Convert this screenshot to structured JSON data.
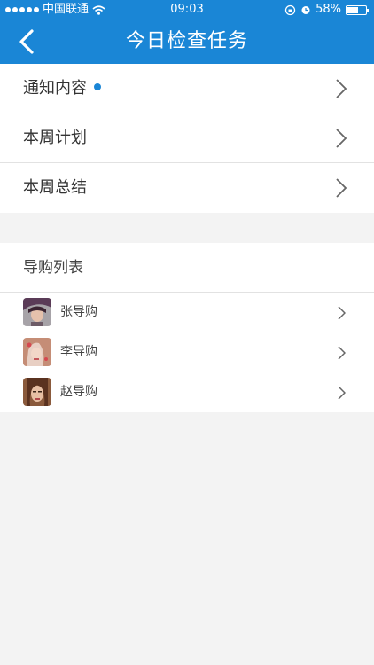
{
  "status_bar": {
    "carrier": "中国联通",
    "time": "09:03",
    "battery": "58%",
    "battery_level": 0.58,
    "signal_icon": "signal-dots-icon",
    "wifi_icon": "wifi-icon",
    "rotation_lock_icon": "rotation-lock-icon",
    "alarm_icon": "alarm-icon"
  },
  "navbar": {
    "title": "今日检查任务",
    "back_icon": "chevron-left-icon"
  },
  "menu": {
    "items": [
      {
        "label": "通知内容",
        "has_dot": true
      },
      {
        "label": "本周计划",
        "has_dot": false
      },
      {
        "label": "本周总结",
        "has_dot": false
      }
    ]
  },
  "guides": {
    "title": "导购列表",
    "items": [
      {
        "name": "张导购"
      },
      {
        "name": "李导购"
      },
      {
        "name": "赵导购"
      }
    ]
  },
  "colors": {
    "accent": "#1a86d6",
    "background": "#f3f3f3",
    "divider": "#e2e2e2"
  }
}
